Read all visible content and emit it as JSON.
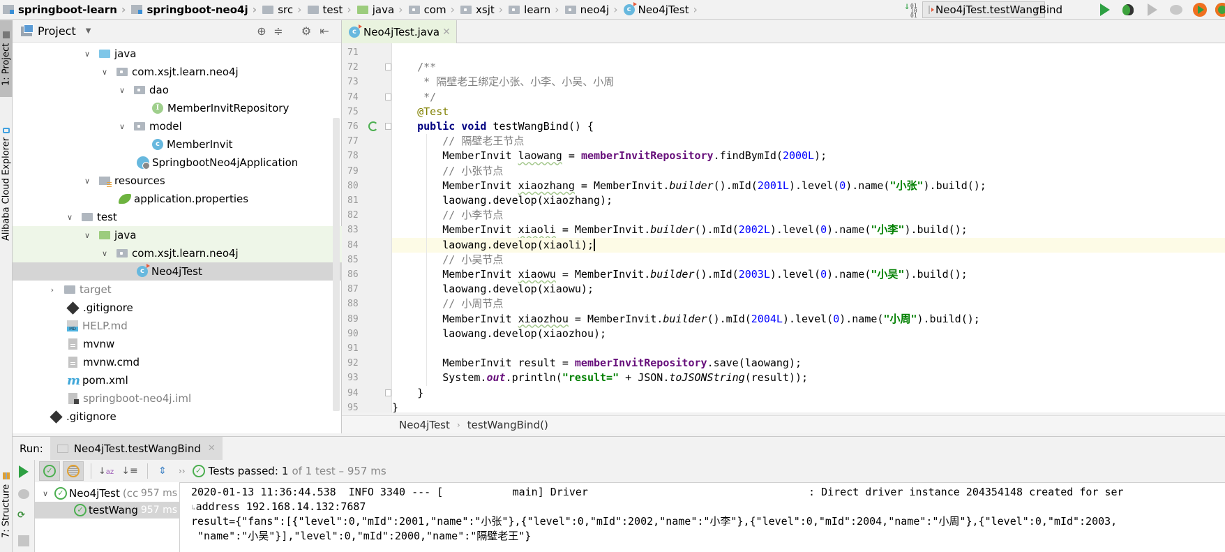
{
  "navbar": {
    "breadcrumbs": [
      {
        "label": "springboot-learn",
        "icon": "module-icon",
        "bold": true
      },
      {
        "label": "springboot-neo4j",
        "icon": "module-icon",
        "bold": true
      },
      {
        "label": "src",
        "icon": "folder-icon"
      },
      {
        "label": "test",
        "icon": "folder-icon"
      },
      {
        "label": "java",
        "icon": "test-source-folder-icon"
      },
      {
        "label": "com",
        "icon": "package-icon"
      },
      {
        "label": "xsjt",
        "icon": "package-icon"
      },
      {
        "label": "learn",
        "icon": "package-icon"
      },
      {
        "label": "neo4j",
        "icon": "package-icon"
      },
      {
        "label": "Neo4jTest",
        "icon": "test-class-icon"
      }
    ],
    "run_config": "Neo4jTest.testWangBind"
  },
  "left_stripe": {
    "project_tab": "1: Project",
    "cloud_tab": "Alibaba Cloud Explorer",
    "structure_tab": "7: Structure"
  },
  "project_panel": {
    "title": "Project",
    "tree": [
      {
        "label": "java",
        "icon": "source-folder-icon",
        "expanded": true,
        "level": 4
      },
      {
        "label": "com.xsjt.learn.neo4j",
        "icon": "package-icon",
        "expanded": true,
        "level": 5
      },
      {
        "label": "dao",
        "icon": "package-icon",
        "expanded": true,
        "level": 6
      },
      {
        "label": "MemberInvitRepository",
        "icon": "interface-icon",
        "level": 7
      },
      {
        "label": "model",
        "icon": "package-icon",
        "expanded": true,
        "level": 6
      },
      {
        "label": "MemberInvit",
        "icon": "class-icon",
        "level": 7
      },
      {
        "label": "SpringbootNeo4jApplication",
        "icon": "spring-boot-class-icon",
        "level": 6
      },
      {
        "label": "resources",
        "icon": "resources-folder-icon",
        "expanded": true,
        "level": 4
      },
      {
        "label": "application.properties",
        "icon": "spring-properties-icon",
        "level": 5
      },
      {
        "label": "test",
        "icon": "folder-icon",
        "expanded": true,
        "level": 3
      },
      {
        "label": "java",
        "icon": "test-source-folder-icon",
        "expanded": true,
        "level": 4
      },
      {
        "label": "com.xsjt.learn.neo4j",
        "icon": "package-icon",
        "expanded": true,
        "level": 5
      },
      {
        "label": "Neo4jTest",
        "icon": "test-class-icon",
        "level": 6
      },
      {
        "label": "target",
        "icon": "folder-icon",
        "expanded": false,
        "level": 2
      },
      {
        "label": ".gitignore",
        "icon": "git-icon",
        "level": 2
      },
      {
        "label": "HELP.md",
        "icon": "markdown-icon",
        "level": 2
      },
      {
        "label": "mvnw",
        "icon": "file-icon",
        "level": 2
      },
      {
        "label": "mvnw.cmd",
        "icon": "file-icon",
        "level": 2
      },
      {
        "label": "pom.xml",
        "icon": "maven-icon",
        "level": 2
      },
      {
        "label": "springboot-neo4j.iml",
        "icon": "iml-icon",
        "level": 2
      },
      {
        "label": ".gitignore",
        "icon": "git-icon",
        "level": 1
      }
    ]
  },
  "editor": {
    "tab_label": "Neo4jTest.java",
    "line_numbers": [
      "71",
      "72",
      "73",
      "74",
      "75",
      "76",
      "77",
      "78",
      "79",
      "80",
      "81",
      "82",
      "83",
      "84",
      "85",
      "86",
      "87",
      "88",
      "89",
      "90",
      "91",
      "92",
      "93",
      "94",
      "95"
    ],
    "code_lines": [
      "",
      "    /**",
      "     * 隔壁老王绑定小张、小李、小吴、小周",
      "     */",
      "    @Test",
      "    public void testWangBind() {",
      "        // 隔壁老王节点",
      "        MemberInvit laowang = memberInvitRepository.findBymId(2000L);",
      "        // 小张节点",
      "        MemberInvit xiaozhang = MemberInvit.builder().mId(2001L).level(0).name(\"小张\").build();",
      "        laowang.develop(xiaozhang);",
      "        // 小李节点",
      "        MemberInvit xiaoli = MemberInvit.builder().mId(2002L).level(0).name(\"小李\").build();",
      "        laowang.develop(xiaoli);",
      "        // 小吴节点",
      "        MemberInvit xiaowu = MemberInvit.builder().mId(2003L).level(0).name(\"小吴\").build();",
      "        laowang.develop(xiaowu);",
      "        // 小周节点",
      "        MemberInvit xiaozhou = MemberInvit.builder().mId(2004L).level(0).name(\"小周\").build();",
      "        laowang.develop(xiaozhou);",
      "",
      "        MemberInvit result = memberInvitRepository.save(laowang);",
      "        System.out.println(\"result=\" + JSON.toJSONString(result));",
      "    }",
      "}"
    ],
    "current_line": "84",
    "breadcrumb": [
      "Neo4jTest",
      "testWangBind()"
    ]
  },
  "run_panel": {
    "label": "Run:",
    "tab_label": "Neo4jTest.testWangBind",
    "status": {
      "prefix": "Tests passed:",
      "passed": "1",
      "suffix": "of 1 test – 957 ms"
    },
    "test_tree": [
      {
        "label": "Neo4jTest",
        "suffix": "(cc",
        "time": "957 ms"
      },
      {
        "label": "testWang",
        "time": "957 ms",
        "selected": true
      }
    ],
    "console_lines": [
      "2020-01-13 11:36:44.538  INFO 3340 --- [           main] Driver                                   : Direct driver instance 204354148 created for ser",
      "address 192.168.14.132:7687",
      "result={\"fans\":[{\"level\":0,\"mId\":2001,\"name\":\"小张\"},{\"level\":0,\"mId\":2002,\"name\":\"小李\"},{\"level\":0,\"mId\":2004,\"name\":\"小周\"},{\"level\":0,\"mId\":2003,",
      " \"name\":\"小吴\"}],\"level\":0,\"mId\":2000,\"name\":\"隔壁老王\"}"
    ]
  },
  "colors": {
    "run_green": "#2ea043",
    "test_green_bg": "#eef6e8",
    "selection_gray": "#d5d5d5",
    "keyword": "#000080",
    "field_purple": "#660e7a",
    "number_blue": "#0000ff",
    "string_green": "#008000",
    "comment_gray": "#808080",
    "annotation_olive": "#808000"
  }
}
